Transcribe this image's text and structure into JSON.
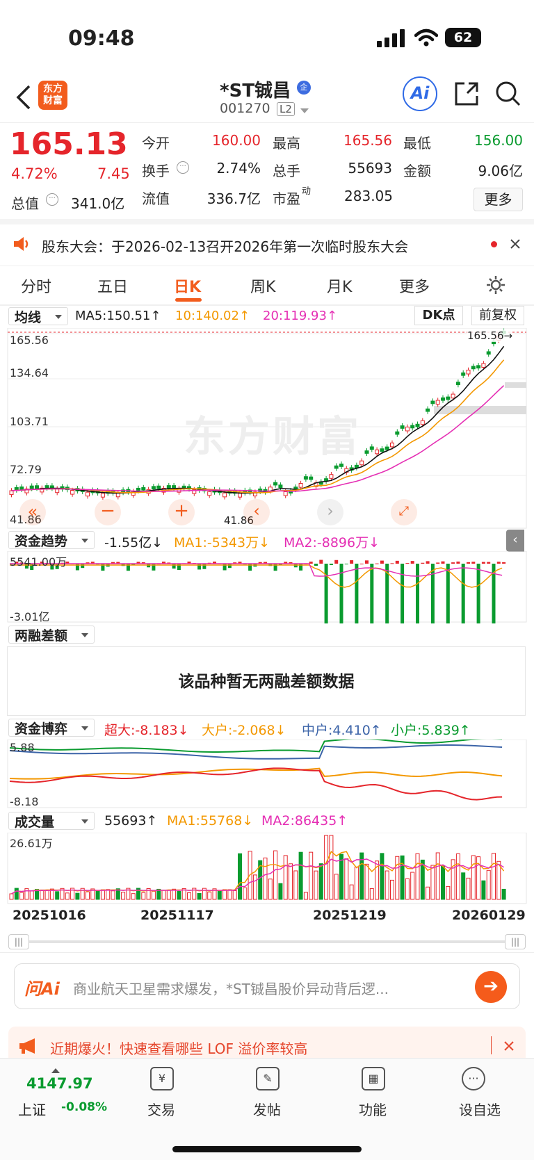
{
  "status": {
    "time": "09:48",
    "battery": "62"
  },
  "header": {
    "name": "*ST铖昌",
    "code": "001270",
    "level": "L2",
    "logo_text": "东方财富",
    "ai": "Ai"
  },
  "quote": {
    "price": "165.13",
    "pct": "4.72%",
    "chg": "7.45",
    "rows": [
      [
        {
          "k": "今开",
          "v": "160.00",
          "c": "red"
        },
        {
          "k": "最高",
          "v": "165.56",
          "c": "red"
        },
        {
          "k": "最低",
          "v": "156.00",
          "c": "green"
        }
      ],
      [
        {
          "k": "换手",
          "v": "2.74%",
          "c": "dark",
          "i": true
        },
        {
          "k": "总手",
          "v": "55693",
          "c": "dark"
        },
        {
          "k": "金额",
          "v": "9.06亿",
          "c": "dark"
        }
      ],
      [
        {
          "k": "流值",
          "v": "336.7亿",
          "c": "dark"
        },
        {
          "k": "市盈",
          "sup": "动",
          "v": "283.05",
          "c": "dark"
        }
      ]
    ],
    "total_label": "总值",
    "total_value": "341.0亿",
    "more": "更多"
  },
  "notice": {
    "text": "股东大会：于2026-02-13召开2026年第一次临时股东大会"
  },
  "tabs": [
    {
      "label": "分时"
    },
    {
      "label": "五日"
    },
    {
      "label": "日K",
      "active": true
    },
    {
      "label": "周K"
    },
    {
      "label": "月K"
    },
    {
      "label": "更多"
    }
  ],
  "kline": {
    "indicator": "均线",
    "ma5": "MA5:150.51↑",
    "ma10": "10:140.02↑",
    "ma20": "20:119.93↑",
    "dk": "DK点",
    "fq": "前复权",
    "y_labels": [
      "165.56",
      "134.64",
      "103.71",
      "72.79",
      "41.86"
    ],
    "high_mark": "165.56→",
    "low_mark": "41.86",
    "watermark": "东方财富"
  },
  "fund_trend": {
    "name": "资金趋势",
    "value": "-1.55亿↓",
    "ma1": "MA1:-5343万↓",
    "ma2": "MA2:-8896万↓",
    "top": "5541.00万",
    "bottom": "-3.01亿"
  },
  "margin": {
    "name": "两融差额",
    "empty_text": "该品种暂无两融差额数据"
  },
  "fund_game": {
    "name": "资金博弈",
    "super": "超大:-8.183↓",
    "large": "大户:-2.068↓",
    "mid": "中户:4.410↑",
    "small": "小户:5.839↑",
    "top": "5.88",
    "bottom": "-8.18"
  },
  "volume": {
    "name": "成交量",
    "value": "55693↑",
    "ma1": "MA1:55768↓",
    "ma2": "MA2:86435↑",
    "top": "26.61万",
    "dates": [
      "20251016",
      "20251117",
      "20251219",
      "20260129"
    ]
  },
  "ai_bar": {
    "brand": "问Ai",
    "text": "商业航天卫星需求爆发，*ST铖昌股价异动背后逻..."
  },
  "promo": {
    "text": "近期爆火！快速查看哪些 LOF 溢价率较高"
  },
  "bottom_nav": {
    "index_value": "4147.97",
    "index_name": "上证",
    "index_pct": "-0.08%",
    "items": [
      {
        "label": "交易"
      },
      {
        "label": "发帖"
      },
      {
        "label": "功能"
      },
      {
        "label": "设自选"
      }
    ]
  },
  "colors": {
    "up": "#e5252b",
    "down": "#0a9b2f",
    "accent": "#ff6a00",
    "ma10": "#f39800",
    "ma20": "#e52fb4",
    "mid": "#3c64a8"
  }
}
